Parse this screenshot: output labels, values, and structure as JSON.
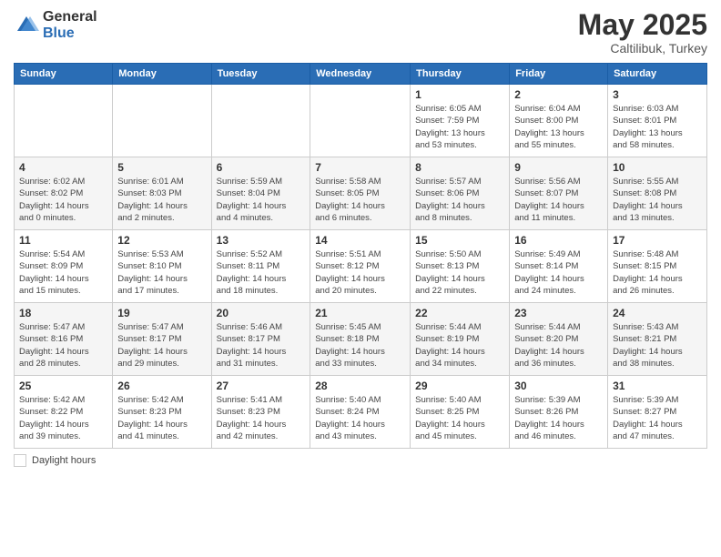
{
  "logo": {
    "general": "General",
    "blue": "Blue"
  },
  "title": {
    "month": "May 2025",
    "location": "Caltilibuk, Turkey"
  },
  "weekdays": [
    "Sunday",
    "Monday",
    "Tuesday",
    "Wednesday",
    "Thursday",
    "Friday",
    "Saturday"
  ],
  "weeks": [
    [
      {
        "day": "",
        "info": ""
      },
      {
        "day": "",
        "info": ""
      },
      {
        "day": "",
        "info": ""
      },
      {
        "day": "",
        "info": ""
      },
      {
        "day": "1",
        "info": "Sunrise: 6:05 AM\nSunset: 7:59 PM\nDaylight: 13 hours\nand 53 minutes."
      },
      {
        "day": "2",
        "info": "Sunrise: 6:04 AM\nSunset: 8:00 PM\nDaylight: 13 hours\nand 55 minutes."
      },
      {
        "day": "3",
        "info": "Sunrise: 6:03 AM\nSunset: 8:01 PM\nDaylight: 13 hours\nand 58 minutes."
      }
    ],
    [
      {
        "day": "4",
        "info": "Sunrise: 6:02 AM\nSunset: 8:02 PM\nDaylight: 14 hours\nand 0 minutes."
      },
      {
        "day": "5",
        "info": "Sunrise: 6:01 AM\nSunset: 8:03 PM\nDaylight: 14 hours\nand 2 minutes."
      },
      {
        "day": "6",
        "info": "Sunrise: 5:59 AM\nSunset: 8:04 PM\nDaylight: 14 hours\nand 4 minutes."
      },
      {
        "day": "7",
        "info": "Sunrise: 5:58 AM\nSunset: 8:05 PM\nDaylight: 14 hours\nand 6 minutes."
      },
      {
        "day": "8",
        "info": "Sunrise: 5:57 AM\nSunset: 8:06 PM\nDaylight: 14 hours\nand 8 minutes."
      },
      {
        "day": "9",
        "info": "Sunrise: 5:56 AM\nSunset: 8:07 PM\nDaylight: 14 hours\nand 11 minutes."
      },
      {
        "day": "10",
        "info": "Sunrise: 5:55 AM\nSunset: 8:08 PM\nDaylight: 14 hours\nand 13 minutes."
      }
    ],
    [
      {
        "day": "11",
        "info": "Sunrise: 5:54 AM\nSunset: 8:09 PM\nDaylight: 14 hours\nand 15 minutes."
      },
      {
        "day": "12",
        "info": "Sunrise: 5:53 AM\nSunset: 8:10 PM\nDaylight: 14 hours\nand 17 minutes."
      },
      {
        "day": "13",
        "info": "Sunrise: 5:52 AM\nSunset: 8:11 PM\nDaylight: 14 hours\nand 18 minutes."
      },
      {
        "day": "14",
        "info": "Sunrise: 5:51 AM\nSunset: 8:12 PM\nDaylight: 14 hours\nand 20 minutes."
      },
      {
        "day": "15",
        "info": "Sunrise: 5:50 AM\nSunset: 8:13 PM\nDaylight: 14 hours\nand 22 minutes."
      },
      {
        "day": "16",
        "info": "Sunrise: 5:49 AM\nSunset: 8:14 PM\nDaylight: 14 hours\nand 24 minutes."
      },
      {
        "day": "17",
        "info": "Sunrise: 5:48 AM\nSunset: 8:15 PM\nDaylight: 14 hours\nand 26 minutes."
      }
    ],
    [
      {
        "day": "18",
        "info": "Sunrise: 5:47 AM\nSunset: 8:16 PM\nDaylight: 14 hours\nand 28 minutes."
      },
      {
        "day": "19",
        "info": "Sunrise: 5:47 AM\nSunset: 8:17 PM\nDaylight: 14 hours\nand 29 minutes."
      },
      {
        "day": "20",
        "info": "Sunrise: 5:46 AM\nSunset: 8:17 PM\nDaylight: 14 hours\nand 31 minutes."
      },
      {
        "day": "21",
        "info": "Sunrise: 5:45 AM\nSunset: 8:18 PM\nDaylight: 14 hours\nand 33 minutes."
      },
      {
        "day": "22",
        "info": "Sunrise: 5:44 AM\nSunset: 8:19 PM\nDaylight: 14 hours\nand 34 minutes."
      },
      {
        "day": "23",
        "info": "Sunrise: 5:44 AM\nSunset: 8:20 PM\nDaylight: 14 hours\nand 36 minutes."
      },
      {
        "day": "24",
        "info": "Sunrise: 5:43 AM\nSunset: 8:21 PM\nDaylight: 14 hours\nand 38 minutes."
      }
    ],
    [
      {
        "day": "25",
        "info": "Sunrise: 5:42 AM\nSunset: 8:22 PM\nDaylight: 14 hours\nand 39 minutes."
      },
      {
        "day": "26",
        "info": "Sunrise: 5:42 AM\nSunset: 8:23 PM\nDaylight: 14 hours\nand 41 minutes."
      },
      {
        "day": "27",
        "info": "Sunrise: 5:41 AM\nSunset: 8:23 PM\nDaylight: 14 hours\nand 42 minutes."
      },
      {
        "day": "28",
        "info": "Sunrise: 5:40 AM\nSunset: 8:24 PM\nDaylight: 14 hours\nand 43 minutes."
      },
      {
        "day": "29",
        "info": "Sunrise: 5:40 AM\nSunset: 8:25 PM\nDaylight: 14 hours\nand 45 minutes."
      },
      {
        "day": "30",
        "info": "Sunrise: 5:39 AM\nSunset: 8:26 PM\nDaylight: 14 hours\nand 46 minutes."
      },
      {
        "day": "31",
        "info": "Sunrise: 5:39 AM\nSunset: 8:27 PM\nDaylight: 14 hours\nand 47 minutes."
      }
    ]
  ],
  "footer": {
    "daylight_label": "Daylight hours"
  }
}
